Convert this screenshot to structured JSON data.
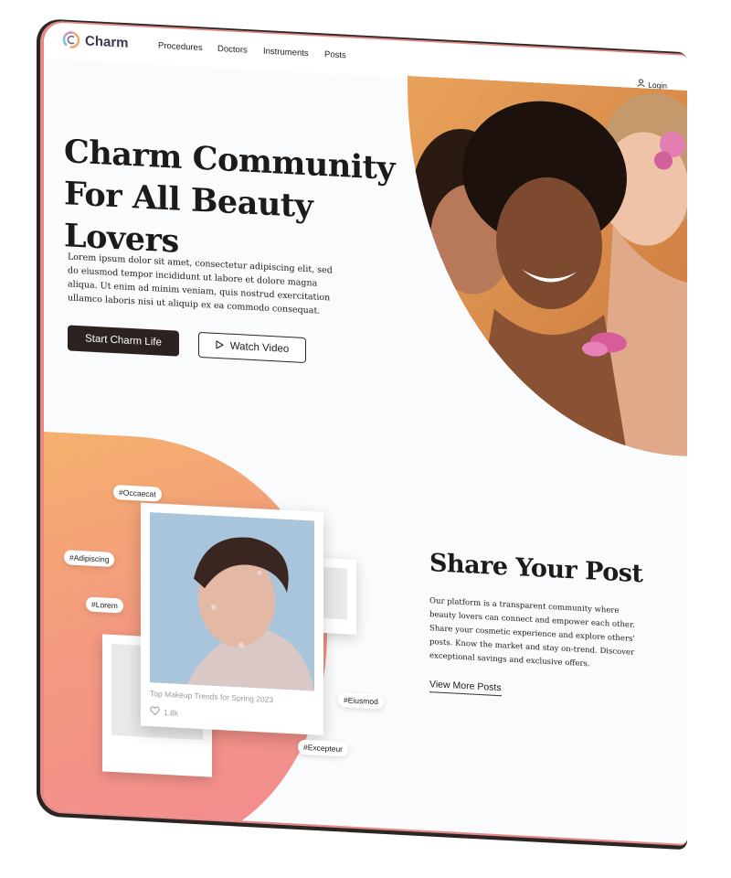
{
  "nav": {
    "brand": "Charm",
    "links": [
      "Procedures",
      "Doctors",
      "Instruments",
      "Posts"
    ],
    "login": "Login"
  },
  "hero": {
    "title_line1": "Charm Community",
    "title_line2": "For All Beauty Lovers",
    "description": "Lorem ipsum dolor sit amet, consectetur adipiscing elit, sed do eiusmod tempor incididunt ut labore et dolore magna aliqua. Ut enim ad minim veniam, quis nostrud exercitation ullamco laboris nisi ut aliquip ex ea commodo consequat.",
    "primary_button": "Start Charm Life",
    "secondary_button": "Watch Video"
  },
  "post_card": {
    "title": "Top Makeup Trends for Spring 2023",
    "likes": "1.8k"
  },
  "tags": [
    "#Occaecat",
    "#Adipiscing",
    "#Lorem",
    "#Eiusmod",
    "#Excepteur"
  ],
  "share": {
    "title": "Share Your Post",
    "description": "Our platform is a transparent community where beauty lovers can connect and empower each other. Share your cosmetic experience and explore others' posts. Know the market and stay on-trend. Discover exceptional savings and exclusive offers.",
    "link": "View More Posts"
  },
  "colors": {
    "primary_button": "#2c2321",
    "gradient_start": "#f6b36b",
    "gradient_end": "#f38a93",
    "device_edge": "#e48a86"
  },
  "icons": [
    "charm-logo-icon",
    "user-icon",
    "play-icon",
    "heart-icon"
  ]
}
